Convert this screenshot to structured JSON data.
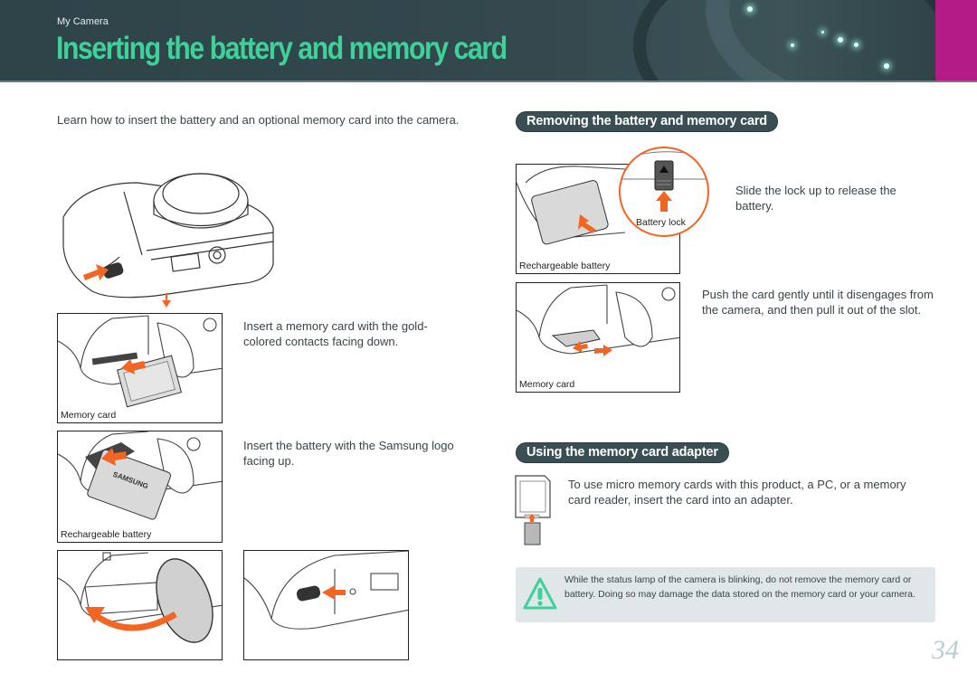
{
  "header": {
    "breadcrumb": "My Camera",
    "title": "Inserting the battery and memory card",
    "colors": {
      "banner": "#34484e",
      "title": "#3ed19a",
      "accent_tab": "#b31b86"
    }
  },
  "intro": "Learn how to insert the battery and an optional memory card into the camera.",
  "insert_steps": [
    {
      "illustration": "camera-underside-unlock-cover",
      "caption": ""
    },
    {
      "illustration": "memory-card-insert",
      "caption": "Memory card",
      "instruction": "Insert a memory card with the gold-colored contacts facing down."
    },
    {
      "illustration": "battery-insert",
      "caption": "Rechargeable battery",
      "instruction": "Insert the battery with the Samsung logo facing up."
    },
    {
      "illustration": "close-battery-cover",
      "caption": ""
    },
    {
      "illustration": "lock-battery-cover",
      "caption": ""
    }
  ],
  "removing": {
    "title": "Removing the battery and memory card",
    "battery": {
      "caption": "Rechargeable battery",
      "callout_label": "Battery lock",
      "instruction": "Slide the lock up to release the battery."
    },
    "card": {
      "caption": "Memory card",
      "instruction": "Push the card gently until it disengages from the camera, and then pull it out of the slot."
    }
  },
  "adapter": {
    "title": "Using the memory card adapter",
    "instruction": "To use micro memory cards with this product, a PC, or a memory card reader, insert the card into an adapter."
  },
  "warning": {
    "icon": "warning-triangle-icon",
    "text": "While the status lamp of the camera is blinking, do not remove the memory card or battery. Doing so may damage the data stored on the memory card or your camera.",
    "color": "#3ed19a"
  },
  "page_number": "34",
  "colors": {
    "arrow": "#f26522",
    "pill": "#3a4f54",
    "warning_bg": "#e1e7e8"
  }
}
